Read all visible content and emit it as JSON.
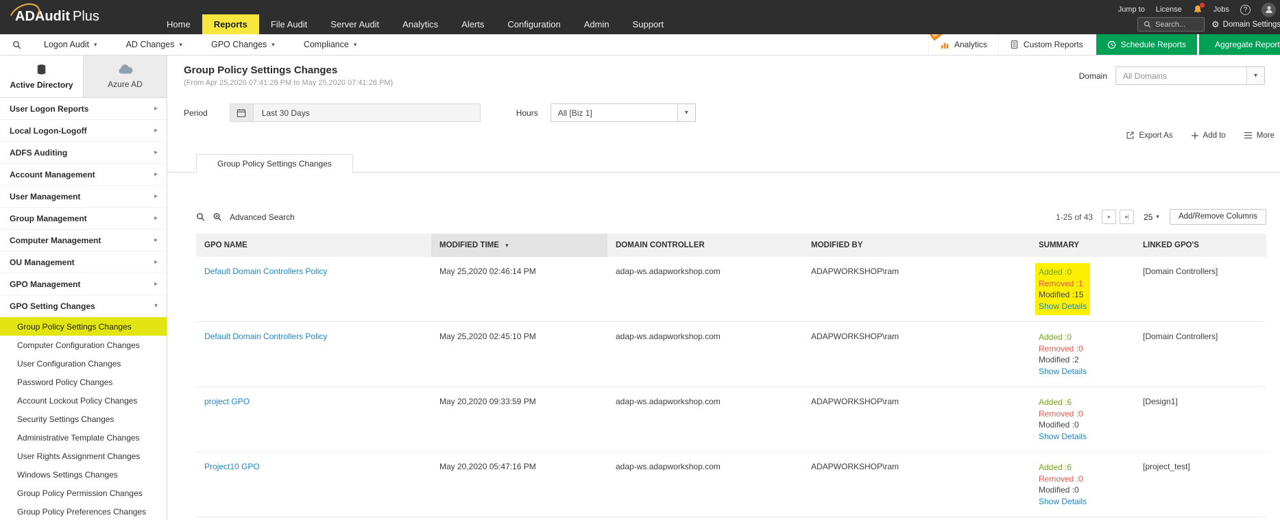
{
  "topbar": {
    "logo_bold": "ADAudit",
    "logo_light": "Plus",
    "nav": [
      {
        "label": "Home",
        "active": false
      },
      {
        "label": "Reports",
        "active": true
      },
      {
        "label": "File Audit",
        "active": false
      },
      {
        "label": "Server Audit",
        "active": false
      },
      {
        "label": "Analytics",
        "active": false
      },
      {
        "label": "Alerts",
        "active": false
      },
      {
        "label": "Configuration",
        "active": false
      },
      {
        "label": "Admin",
        "active": false
      },
      {
        "label": "Support",
        "active": false
      }
    ],
    "jump_to_label": "Jump to",
    "license_label": "License",
    "jobs_label": "Jobs",
    "help_label": "?",
    "search_label": "Search...",
    "domain_settings_label": "Domain Settings"
  },
  "menubar": {
    "menus": [
      {
        "label": "Logon Audit"
      },
      {
        "label": "AD Changes"
      },
      {
        "label": "GPO Changes"
      },
      {
        "label": "Compliance"
      }
    ],
    "new_badge": "NEW",
    "analytics_label": "Analytics",
    "custom_reports_label": "Custom Reports",
    "schedule_reports_label": "Schedule Reports",
    "aggregate_report_label": "Aggregate Report"
  },
  "sidebar": {
    "tabs": [
      {
        "label": "Active Directory",
        "active": true
      },
      {
        "label": "Azure AD",
        "active": false
      }
    ],
    "items": [
      {
        "label": "User Logon Reports",
        "expanded": false
      },
      {
        "label": "Local Logon-Logoff",
        "expanded": false
      },
      {
        "label": "ADFS Auditing",
        "expanded": false
      },
      {
        "label": "Account Management",
        "expanded": false
      },
      {
        "label": "User Management",
        "expanded": false
      },
      {
        "label": "Group Management",
        "expanded": false
      },
      {
        "label": "Computer Management",
        "expanded": false
      },
      {
        "label": "OU Management",
        "expanded": false
      },
      {
        "label": "GPO Management",
        "expanded": false
      },
      {
        "label": "GPO Setting Changes",
        "expanded": true
      }
    ],
    "sub_items": [
      {
        "label": "Group Policy Settings Changes",
        "active": true
      },
      {
        "label": "Computer Configuration Changes",
        "active": false
      },
      {
        "label": "User Configuration Changes",
        "active": false
      },
      {
        "label": "Password Policy Changes",
        "active": false
      },
      {
        "label": "Account Lockout Policy Changes",
        "active": false
      },
      {
        "label": "Security Settings Changes",
        "active": false
      },
      {
        "label": "Administrative Template Changes",
        "active": false
      },
      {
        "label": "User Rights Assignment Changes",
        "active": false
      },
      {
        "label": "Windows Settings Changes",
        "active": false
      },
      {
        "label": "Group Policy Permission Changes",
        "active": false
      },
      {
        "label": "Group Policy Preferences Changes",
        "active": false
      }
    ]
  },
  "main": {
    "title": "Group Policy Settings Changes",
    "subtitle": "(From Apr 25,2020 07:41:28 PM to May 25,2020 07:41:28 PM)",
    "domain": {
      "label": "Domain",
      "value": "All Domains"
    },
    "filters": {
      "period_label": "Period",
      "period_value": "Last 30 Days",
      "hours_label": "Hours",
      "hours_value": "All [Biz 1]"
    },
    "actions": [
      {
        "label": "Export As"
      },
      {
        "label": "Add to"
      },
      {
        "label": "More"
      }
    ],
    "tab_label": "Group Policy Settings Changes",
    "table": {
      "advanced_search_label": "Advanced Search",
      "pagination": {
        "range": "1-25 of 43",
        "page_size": "25",
        "columns_button": "Add/Remove Columns"
      },
      "headers": [
        "GPO NAME",
        "MODIFIED TIME",
        "DOMAIN CONTROLLER",
        "MODIFIED BY",
        "SUMMARY",
        "LINKED GPO'S"
      ],
      "sorted_column": "MODIFIED TIME",
      "sort_direction": "desc",
      "rows": [
        {
          "gpo_name": "Default Domain Controllers Policy",
          "modified_time": "May 25,2020 02:46:14 PM",
          "domain_controller": "adap-ws.adapworkshop.com",
          "modified_by": "ADAPWORKSHOP\\ram",
          "summary": {
            "added": "Added :0",
            "removed": "Removed :1",
            "modified": "Modified :15",
            "details_link": "Show Details"
          },
          "linked_gpos": "[Domain Controllers]",
          "summary_highlighted": true
        },
        {
          "gpo_name": "Default Domain Controllers Policy",
          "modified_time": "May 25,2020 02:45:10 PM",
          "domain_controller": "adap-ws.adapworkshop.com",
          "modified_by": "ADAPWORKSHOP\\ram",
          "summary": {
            "added": "Added :0",
            "removed": "Removed :0",
            "modified": "Modified :2",
            "details_link": "Show Details"
          },
          "linked_gpos": "[Domain Controllers]",
          "summary_highlighted": false
        },
        {
          "gpo_name": "project GPO",
          "modified_time": "May 20,2020 09:33:59 PM",
          "domain_controller": "adap-ws.adapworkshop.com",
          "modified_by": "ADAPWORKSHOP\\ram",
          "summary": {
            "added": "Added :6",
            "removed": "Removed :0",
            "modified": "Modified :0",
            "details_link": "Show Details"
          },
          "linked_gpos": "[Design1]",
          "summary_highlighted": false
        },
        {
          "gpo_name": "Project10 GPO",
          "modified_time": "May 20,2020 05:47:16 PM",
          "domain_controller": "adap-ws.adapworkshop.com",
          "modified_by": "ADAPWORKSHOP\\ram",
          "summary": {
            "added": "Added :6",
            "removed": "Removed :0",
            "modified": "Modified :0",
            "details_link": "Show Details"
          },
          "linked_gpos": "[project_test]",
          "summary_highlighted": false
        }
      ]
    }
  },
  "colors": {
    "topbar_bg": "#2e2e2e",
    "nav_highlight_yellow": "#f7e63c",
    "sidebar_selected_yellow": "#e2e512",
    "summary_highlight_yellow": "#fcf000",
    "green_button": "#00a155",
    "link_blue": "#1d86c8",
    "added_green": "#76a21c",
    "removed_red": "#e2574c",
    "new_badge_orange": "#f28a1f"
  }
}
